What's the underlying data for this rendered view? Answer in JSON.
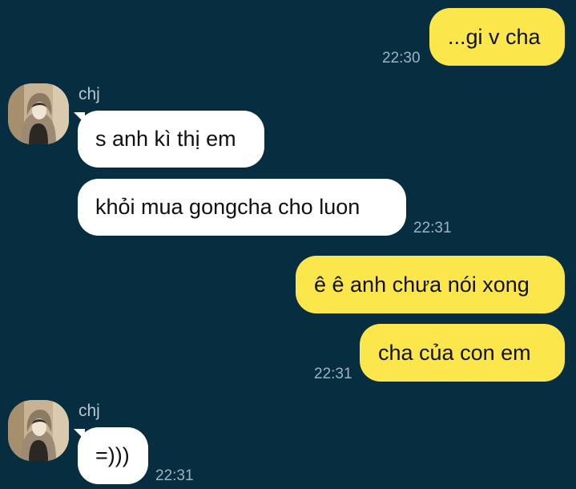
{
  "conversation": {
    "messages": [
      {
        "direction": "outgoing",
        "text": "...gi v cha",
        "time": "22:30"
      },
      {
        "direction": "incoming",
        "sender": "chj",
        "text": "s anh kì thị em"
      },
      {
        "direction": "incoming",
        "text": "khỏi mua gongcha cho luon",
        "time": "22:31"
      },
      {
        "direction": "outgoing",
        "text": "ê ê anh chưa nói xong"
      },
      {
        "direction": "outgoing",
        "text": "cha của con em",
        "time": "22:31"
      },
      {
        "direction": "incoming",
        "sender": "chj",
        "text": "=)))",
        "time": "22:31"
      }
    ]
  },
  "colors": {
    "background": "#062d40",
    "outgoing_bubble": "#fbe74b",
    "incoming_bubble": "#ffffff",
    "timestamp": "#9fb3bf",
    "sender_name": "#b7c6cf"
  },
  "icons": {
    "avatar": "avatar-photo"
  }
}
